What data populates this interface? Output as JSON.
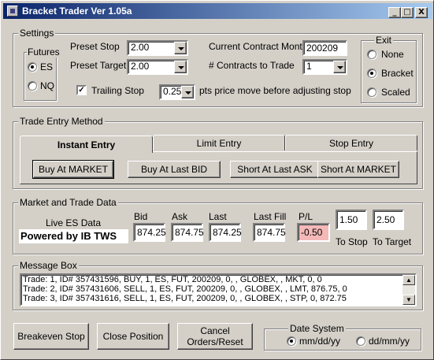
{
  "window": {
    "title": "Bracket Trader Ver 1.05a",
    "controls": {
      "minimize": "_",
      "maximize": "□",
      "close": "X"
    }
  },
  "settings": {
    "group_label": "Settings",
    "futures": {
      "label": "Futures",
      "options": [
        "ES",
        "NQ"
      ],
      "selected": "ES"
    },
    "preset_stop_label": "Preset Stop",
    "preset_stop_value": "2.00",
    "preset_target_label": "Preset Target",
    "preset_target_value": "2.00",
    "trailing_stop_label": "Trailing Stop",
    "trailing_stop_checked": true,
    "trail_value": "0.25",
    "trail_suffix": "pts price move before adjusting stop",
    "contract_month_label": "Current Contract Month",
    "contract_month_value": "200209",
    "contracts_label": "# Contracts to Trade",
    "contracts_value": "1",
    "exit": {
      "label": "Exit",
      "options": [
        "None",
        "Bracket",
        "Scaled"
      ],
      "selected": "Bracket"
    }
  },
  "trade_entry": {
    "group_label": "Trade Entry Method",
    "tabs": [
      "Instant Entry",
      "Limit Entry",
      "Stop Entry"
    ],
    "active_tab": "Instant Entry",
    "buttons": [
      "Buy At MARKET",
      "Buy At Last BID",
      "Short At Last ASK",
      "Short At MARKET"
    ]
  },
  "market_data": {
    "group_label": "Market and Trade Data",
    "live_label": "Live ES Data",
    "powered_by": "Powered by IB TWS",
    "headers": {
      "bid": "Bid",
      "ask": "Ask",
      "last": "Last",
      "last_fill": "Last Fill",
      "pl": "P/L"
    },
    "values": {
      "bid": "874.25",
      "ask": "874.75",
      "last": "874.25",
      "last_fill": "874.75",
      "pl": "-0.50"
    },
    "to_stop_value": "1.50",
    "to_stop_label": "To Stop",
    "to_target_value": "2.50",
    "to_target_label": "To Target",
    "pl_color": "#f4b8b8"
  },
  "message_box": {
    "group_label": "Message Box",
    "lines": [
      "Trade: 1,  ID# 357431596,   BUY,   1,   ES,   FUT,   200209,   0,   ,   GLOBEX,   ,   MKT,   0,   0",
      "Trade: 2,  ID# 357431606,   SELL,   1,   ES,   FUT,   200209,   0,   ,   GLOBEX,   ,   LMT,   876.75,   0",
      "Trade: 3,  ID# 357431616,   SELL,   1,   ES,   FUT,   200209,   0,   ,   GLOBEX,   ,   STP,   0,   872.75"
    ]
  },
  "bottom": {
    "breakeven": "Breakeven Stop",
    "close_position": "Close Position",
    "cancel_orders_line1": "Cancel",
    "cancel_orders_line2": "Orders/Reset",
    "date_system": {
      "label": "Date System",
      "options": [
        "mm/dd/yy",
        "dd/mm/yy"
      ],
      "selected": "mm/dd/yy"
    }
  },
  "colors": {
    "titlebar_start": "#0a246a",
    "titlebar_end": "#a6caf0",
    "face": "#d4d0c8"
  }
}
